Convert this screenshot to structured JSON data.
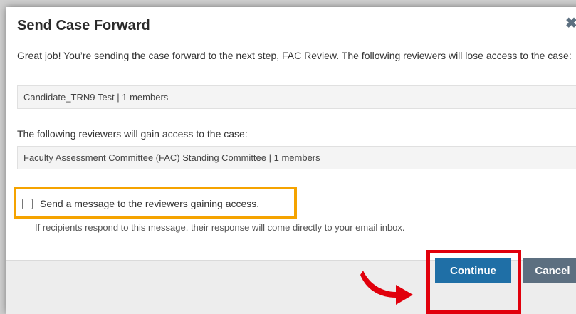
{
  "dialog": {
    "title": "Send Case Forward",
    "close_icon": "close-icon",
    "intro_text": "Great job! You’re sending the case forward to the next step, FAC Review. The following reviewers will lose access to the case:",
    "losing_group": "Candidate_TRN9 Test | 1 members",
    "gain_label": "The following reviewers will gain access to the case:",
    "gaining_group": "Faculty Assessment Committee (FAC) Standing Committee | 1 members",
    "send_message_label": "Send a message to the reviewers gaining access.",
    "send_message_checked": false,
    "hint_text": "If recipients respond to this message, their response will come directly to your email inbox."
  },
  "buttons": {
    "continue_label": "Continue",
    "cancel_label": "Cancel"
  },
  "colors": {
    "primary_button": "#1f6fa6",
    "secondary_button": "#5c6f80",
    "highlight_orange": "#f5a300",
    "highlight_red": "#e1000c"
  }
}
